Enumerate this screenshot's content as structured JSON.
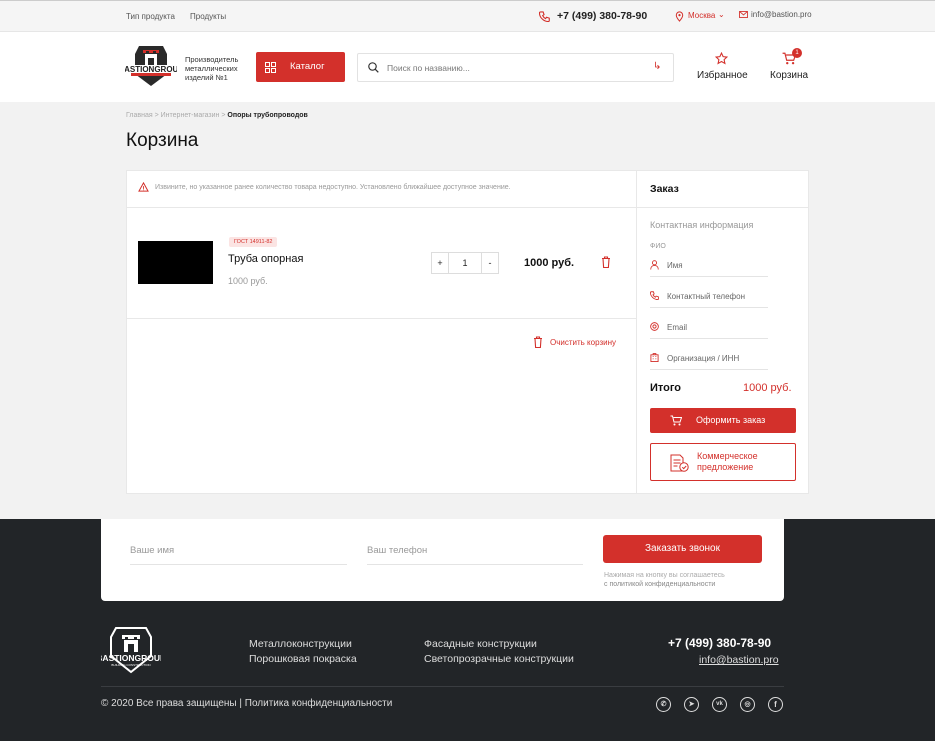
{
  "topbar": {
    "link1": "Тип продукта",
    "link2": "Продукты",
    "phone": "+7 (499) 380-78-90",
    "city": "Москва",
    "email": "info@bastion.pro"
  },
  "header": {
    "logo_tagline": "Производитель металлических изделий №1",
    "catalog_label": "Каталог",
    "search_placeholder": "Поиск по названию...",
    "favorites_label": "Избранное",
    "cart_label": "Корзина",
    "cart_count": "1"
  },
  "breadcrumb": {
    "item1": "Главная",
    "sep1": " > ",
    "item2": "Интернет-магазин",
    "sep2": " > ",
    "item3": "Опоры трубопроводов"
  },
  "page_title": "Корзина",
  "alert_text": "Извините, но указанное ранее количество товара недоступно. Установлено ближайшее доступное значение.",
  "cart_item": {
    "badge": "ГОСТ 14911-82",
    "name": "Труба опорная",
    "unit_price": "1000 руб.",
    "qty": "1",
    "minus": "-",
    "plus": "+",
    "total": "1000 руб."
  },
  "clear_cart_label": "Очистить корзину",
  "order": {
    "title": "Заказ",
    "contact_heading": "Контактная информация",
    "fio_label": "ФИО",
    "name_placeholder": "Имя",
    "phone_placeholder": "Контактный телефон",
    "email_placeholder": "Email",
    "org_placeholder": "Организация / ИНН",
    "total_label": "Итого",
    "total_value": "1000 руб.",
    "submit_label": "Оформить заказ",
    "offer_label_1": "Коммерческое",
    "offer_label_2": "предложение"
  },
  "callback": {
    "name_placeholder": "Ваше имя",
    "phone_placeholder": "Ваш телефон",
    "button": "Заказать звонок",
    "note_1": "Нажимая на кнопку вы соглашаетесь",
    "note_2": "с политикой конфиденциальности"
  },
  "footer": {
    "link1": "Металлоконструкции",
    "link2": "Порошковая покраска",
    "link3": "Фасадные конструкции",
    "link4": "Светопрозрачные конструкции",
    "phone": "+7 (499) 380-78-90",
    "email": "info@bastion.pro",
    "copyright": "© 2020 Все права защищены",
    "divider": "|",
    "privacy": "Политика конфиденциальности"
  },
  "social_icons": [
    "whatsapp-icon",
    "telegram-icon",
    "vk-icon",
    "instagram-icon",
    "facebook-icon"
  ],
  "colors": {
    "accent": "#d3302b",
    "footer_bg": "#222528",
    "page_bg": "#f2f2f2"
  }
}
